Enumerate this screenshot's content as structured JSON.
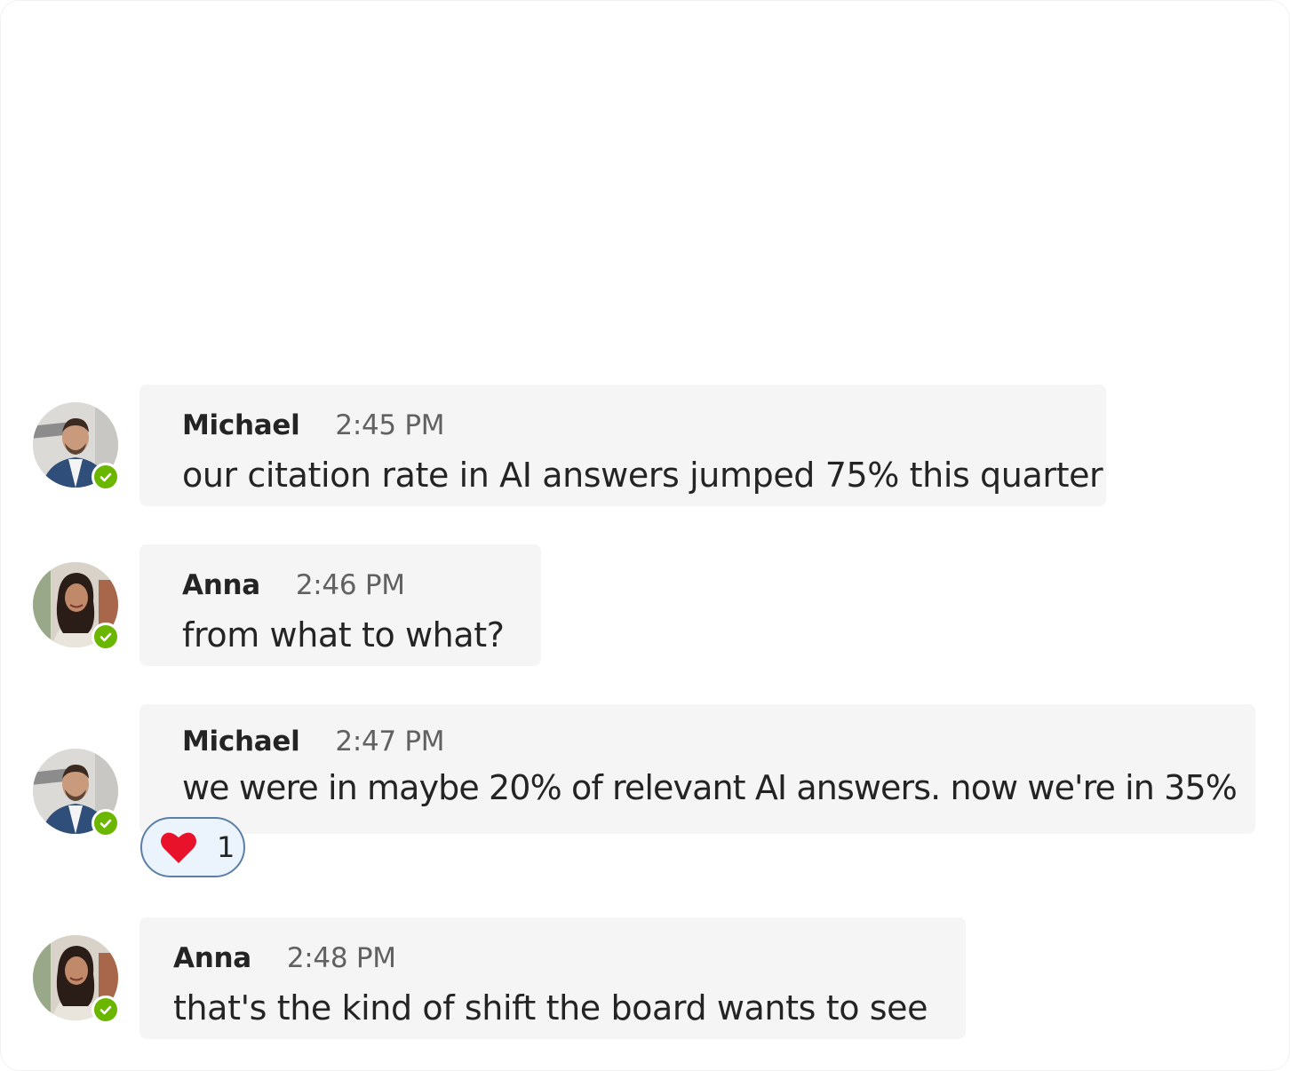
{
  "messages": [
    {
      "author": "Michael",
      "time": "2:45 PM",
      "text": "our citation rate in AI answers jumped 75% this quarter",
      "avatar": "man-avatar",
      "presence": "available"
    },
    {
      "author": "Anna",
      "time": "2:46 PM",
      "text": "from what to what?",
      "avatar": "woman-avatar",
      "presence": "available"
    },
    {
      "author": "Michael",
      "time": "2:47 PM",
      "text": "we were in maybe 20% of relevant AI answers. now we're in 35%",
      "avatar": "man-avatar",
      "presence": "available",
      "reaction": {
        "icon": "heart-icon",
        "count": "1"
      }
    },
    {
      "author": "Anna",
      "time": "2:48 PM",
      "text": "that's the kind of shift the board wants to see",
      "avatar": "woman-avatar",
      "presence": "available"
    }
  ],
  "colors": {
    "bubble": "#f5f5f5",
    "presence_available": "#6bb700",
    "reaction_border": "#5b7fa6",
    "reaction_bg": "#ebf3fc",
    "heart": "#e8132b"
  }
}
